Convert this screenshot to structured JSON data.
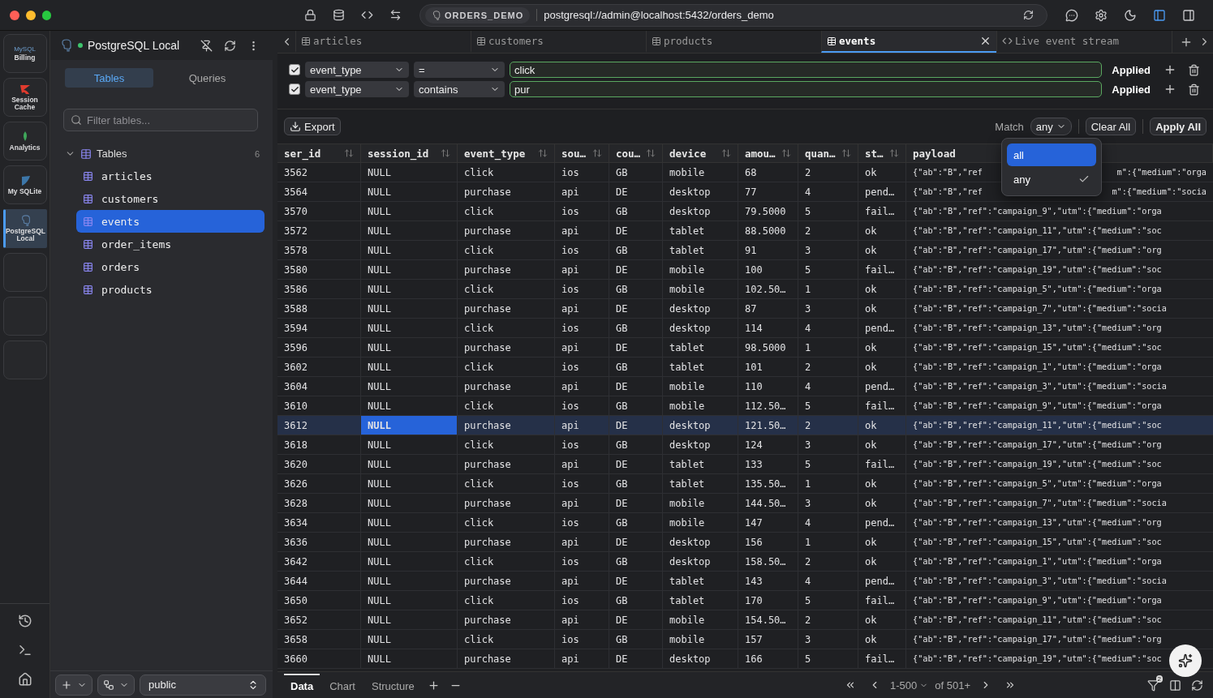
{
  "titlebar": {
    "connection_badge": "ORDERS_DEMO",
    "url": "postgresql://admin@localhost:5432/orders_demo"
  },
  "connections": [
    {
      "kind": "mysql",
      "label": "Billing",
      "logo_text": "MySQL",
      "selected": false
    },
    {
      "kind": "redis",
      "label": "Session Cache",
      "selected": false
    },
    {
      "kind": "mongo",
      "label": "Analytics",
      "selected": false
    },
    {
      "kind": "sqlite",
      "label": "My SQLite",
      "selected": false
    },
    {
      "kind": "postgres",
      "label": "PostgreSQL Local",
      "selected": true
    },
    {
      "kind": "empty",
      "selected": false
    },
    {
      "kind": "empty",
      "selected": false
    },
    {
      "kind": "empty",
      "selected": false
    }
  ],
  "sidebar": {
    "title": "PostgreSQL Local",
    "connected": true,
    "tabs": [
      {
        "label": "Tables",
        "selected": true
      },
      {
        "label": "Queries",
        "selected": false
      }
    ],
    "filter": {
      "placeholder": "Filter tables..."
    },
    "tree": {
      "label": "Tables",
      "count": "6",
      "expanded": true,
      "children": [
        {
          "label": "articles",
          "selected": false
        },
        {
          "label": "customers",
          "selected": false
        },
        {
          "label": "events",
          "selected": true
        },
        {
          "label": "order_items",
          "selected": false
        },
        {
          "label": "orders",
          "selected": false
        },
        {
          "label": "products",
          "selected": false
        }
      ]
    },
    "schema": "public"
  },
  "editor_tabs": [
    {
      "kind": "table",
      "label": "articles",
      "selected": false,
      "closable": false
    },
    {
      "kind": "table",
      "label": "customers",
      "selected": false,
      "closable": false
    },
    {
      "kind": "table",
      "label": "products",
      "selected": false,
      "closable": false
    },
    {
      "kind": "table",
      "label": "events",
      "selected": true,
      "closable": true
    },
    {
      "kind": "stream",
      "label": "Live event stream",
      "selected": false,
      "closable": false
    }
  ],
  "filters": [
    {
      "enabled": true,
      "column": "event_type",
      "operator": "=",
      "value": "click",
      "status": "Applied"
    },
    {
      "enabled": true,
      "column": "event_type",
      "operator": "contains",
      "value": "pur",
      "status": "Applied"
    }
  ],
  "toolbar": {
    "export": "Export",
    "match_label": "Match",
    "match_value": "any",
    "clear": "Clear All",
    "apply": "Apply All"
  },
  "match_menu": [
    {
      "label": "all",
      "highlighted": true,
      "checked": false
    },
    {
      "label": "any",
      "highlighted": false,
      "checked": true
    }
  ],
  "table": {
    "columns": [
      {
        "label": "ser_id"
      },
      {
        "label": "session_id"
      },
      {
        "label": "event_type"
      },
      {
        "label": "sou…"
      },
      {
        "label": "cou…"
      },
      {
        "label": "device"
      },
      {
        "label": "amou…"
      },
      {
        "label": "quan…"
      },
      {
        "label": "st…"
      },
      {
        "label": "payload"
      }
    ],
    "rows": [
      {
        "selected": false,
        "cells": [
          "3562",
          "NULL",
          "click",
          "ios",
          "GB",
          "mobile",
          "68",
          "2",
          "ok",
          {
            "parts": [
              "{\"ab\":\"B\",\"ref",
              "m\":{\"medium\":\"orga"
            ]
          }
        ]
      },
      {
        "selected": false,
        "cells": [
          "3564",
          "NULL",
          "purchase",
          "api",
          "DE",
          "desktop",
          "77",
          "4",
          "pend…",
          {
            "parts": [
              "{\"ab\":\"B\",\"ref",
              "m\":{\"medium\":\"socia"
            ]
          }
        ]
      },
      {
        "selected": false,
        "cells": [
          "3570",
          "NULL",
          "click",
          "ios",
          "GB",
          "desktop",
          "79.5000",
          "5",
          "fail…",
          "{\"ab\":\"B\",\"ref\":\"campaign_9\",\"utm\":{\"medium\":\"orga"
        ]
      },
      {
        "selected": false,
        "cells": [
          "3572",
          "NULL",
          "purchase",
          "api",
          "DE",
          "tablet",
          "88.5000",
          "2",
          "ok",
          "{\"ab\":\"B\",\"ref\":\"campaign_11\",\"utm\":{\"medium\":\"soc"
        ]
      },
      {
        "selected": false,
        "cells": [
          "3578",
          "NULL",
          "click",
          "ios",
          "GB",
          "tablet",
          "91",
          "3",
          "ok",
          "{\"ab\":\"B\",\"ref\":\"campaign_17\",\"utm\":{\"medium\":\"org"
        ]
      },
      {
        "selected": false,
        "cells": [
          "3580",
          "NULL",
          "purchase",
          "api",
          "DE",
          "mobile",
          "100",
          "5",
          "fail…",
          "{\"ab\":\"B\",\"ref\":\"campaign_19\",\"utm\":{\"medium\":\"soc"
        ]
      },
      {
        "selected": false,
        "cells": [
          "3586",
          "NULL",
          "click",
          "ios",
          "GB",
          "mobile",
          "102.50…",
          "1",
          "ok",
          "{\"ab\":\"B\",\"ref\":\"campaign_5\",\"utm\":{\"medium\":\"orga"
        ]
      },
      {
        "selected": false,
        "cells": [
          "3588",
          "NULL",
          "purchase",
          "api",
          "DE",
          "desktop",
          "87",
          "3",
          "ok",
          "{\"ab\":\"B\",\"ref\":\"campaign_7\",\"utm\":{\"medium\":\"socia"
        ]
      },
      {
        "selected": false,
        "cells": [
          "3594",
          "NULL",
          "click",
          "ios",
          "GB",
          "desktop",
          "114",
          "4",
          "pend…",
          "{\"ab\":\"B\",\"ref\":\"campaign_13\",\"utm\":{\"medium\":\"org"
        ]
      },
      {
        "selected": false,
        "cells": [
          "3596",
          "NULL",
          "purchase",
          "api",
          "DE",
          "tablet",
          "98.5000",
          "1",
          "ok",
          "{\"ab\":\"B\",\"ref\":\"campaign_15\",\"utm\":{\"medium\":\"soc"
        ]
      },
      {
        "selected": false,
        "cells": [
          "3602",
          "NULL",
          "click",
          "ios",
          "GB",
          "tablet",
          "101",
          "2",
          "ok",
          "{\"ab\":\"B\",\"ref\":\"campaign_1\",\"utm\":{\"medium\":\"orga"
        ]
      },
      {
        "selected": false,
        "cells": [
          "3604",
          "NULL",
          "purchase",
          "api",
          "DE",
          "mobile",
          "110",
          "4",
          "pend…",
          "{\"ab\":\"B\",\"ref\":\"campaign_3\",\"utm\":{\"medium\":\"socia"
        ]
      },
      {
        "selected": false,
        "cells": [
          "3610",
          "NULL",
          "click",
          "ios",
          "GB",
          "mobile",
          "112.50…",
          "5",
          "fail…",
          "{\"ab\":\"B\",\"ref\":\"campaign_9\",\"utm\":{\"medium\":\"orga"
        ]
      },
      {
        "selected": true,
        "cells": [
          "3612",
          {
            "text": "NULL",
            "selected": true
          },
          "purchase",
          "api",
          "DE",
          "desktop",
          "121.50…",
          "2",
          "ok",
          "{\"ab\":\"B\",\"ref\":\"campaign_11\",\"utm\":{\"medium\":\"soc"
        ]
      },
      {
        "selected": false,
        "cells": [
          "3618",
          "NULL",
          "click",
          "ios",
          "GB",
          "desktop",
          "124",
          "3",
          "ok",
          "{\"ab\":\"B\",\"ref\":\"campaign_17\",\"utm\":{\"medium\":\"org"
        ]
      },
      {
        "selected": false,
        "cells": [
          "3620",
          "NULL",
          "purchase",
          "api",
          "DE",
          "tablet",
          "133",
          "5",
          "fail…",
          "{\"ab\":\"B\",\"ref\":\"campaign_19\",\"utm\":{\"medium\":\"soc"
        ]
      },
      {
        "selected": false,
        "cells": [
          "3626",
          "NULL",
          "click",
          "ios",
          "GB",
          "tablet",
          "135.50…",
          "1",
          "ok",
          "{\"ab\":\"B\",\"ref\":\"campaign_5\",\"utm\":{\"medium\":\"orga"
        ]
      },
      {
        "selected": false,
        "cells": [
          "3628",
          "NULL",
          "purchase",
          "api",
          "DE",
          "mobile",
          "144.50…",
          "3",
          "ok",
          "{\"ab\":\"B\",\"ref\":\"campaign_7\",\"utm\":{\"medium\":\"socia"
        ]
      },
      {
        "selected": false,
        "cells": [
          "3634",
          "NULL",
          "click",
          "ios",
          "GB",
          "mobile",
          "147",
          "4",
          "pend…",
          "{\"ab\":\"B\",\"ref\":\"campaign_13\",\"utm\":{\"medium\":\"org"
        ]
      },
      {
        "selected": false,
        "cells": [
          "3636",
          "NULL",
          "purchase",
          "api",
          "DE",
          "desktop",
          "156",
          "1",
          "ok",
          "{\"ab\":\"B\",\"ref\":\"campaign_15\",\"utm\":{\"medium\":\"soc"
        ]
      },
      {
        "selected": false,
        "cells": [
          "3642",
          "NULL",
          "click",
          "ios",
          "GB",
          "desktop",
          "158.50…",
          "2",
          "ok",
          "{\"ab\":\"B\",\"ref\":\"campaign_1\",\"utm\":{\"medium\":\"orga"
        ]
      },
      {
        "selected": false,
        "cells": [
          "3644",
          "NULL",
          "purchase",
          "api",
          "DE",
          "tablet",
          "143",
          "4",
          "pend…",
          "{\"ab\":\"B\",\"ref\":\"campaign_3\",\"utm\":{\"medium\":\"socia"
        ]
      },
      {
        "selected": false,
        "cells": [
          "3650",
          "NULL",
          "click",
          "ios",
          "GB",
          "tablet",
          "170",
          "5",
          "fail…",
          "{\"ab\":\"B\",\"ref\":\"campaign_9\",\"utm\":{\"medium\":\"orga"
        ]
      },
      {
        "selected": false,
        "cells": [
          "3652",
          "NULL",
          "purchase",
          "api",
          "DE",
          "mobile",
          "154.50…",
          "2",
          "ok",
          "{\"ab\":\"B\",\"ref\":\"campaign_11\",\"utm\":{\"medium\":\"soc"
        ]
      },
      {
        "selected": false,
        "cells": [
          "3658",
          "NULL",
          "click",
          "ios",
          "GB",
          "mobile",
          "157",
          "3",
          "ok",
          "{\"ab\":\"B\",\"ref\":\"campaign_17\",\"utm\":{\"medium\":\"org"
        ]
      },
      {
        "selected": false,
        "cells": [
          "3660",
          "NULL",
          "purchase",
          "api",
          "DE",
          "desktop",
          "166",
          "5",
          "fail…",
          "{\"ab\":\"B\",\"ref\":\"campaign_19\",\"utm\":{\"medium\":\"soc"
        ]
      }
    ]
  },
  "bottom_bar": {
    "views": [
      {
        "label": "Data",
        "selected": true
      },
      {
        "label": "Chart",
        "selected": false
      },
      {
        "label": "Structure",
        "selected": false
      }
    ],
    "page_range": "1-500",
    "total": "of 501+",
    "filter_count": "2"
  }
}
